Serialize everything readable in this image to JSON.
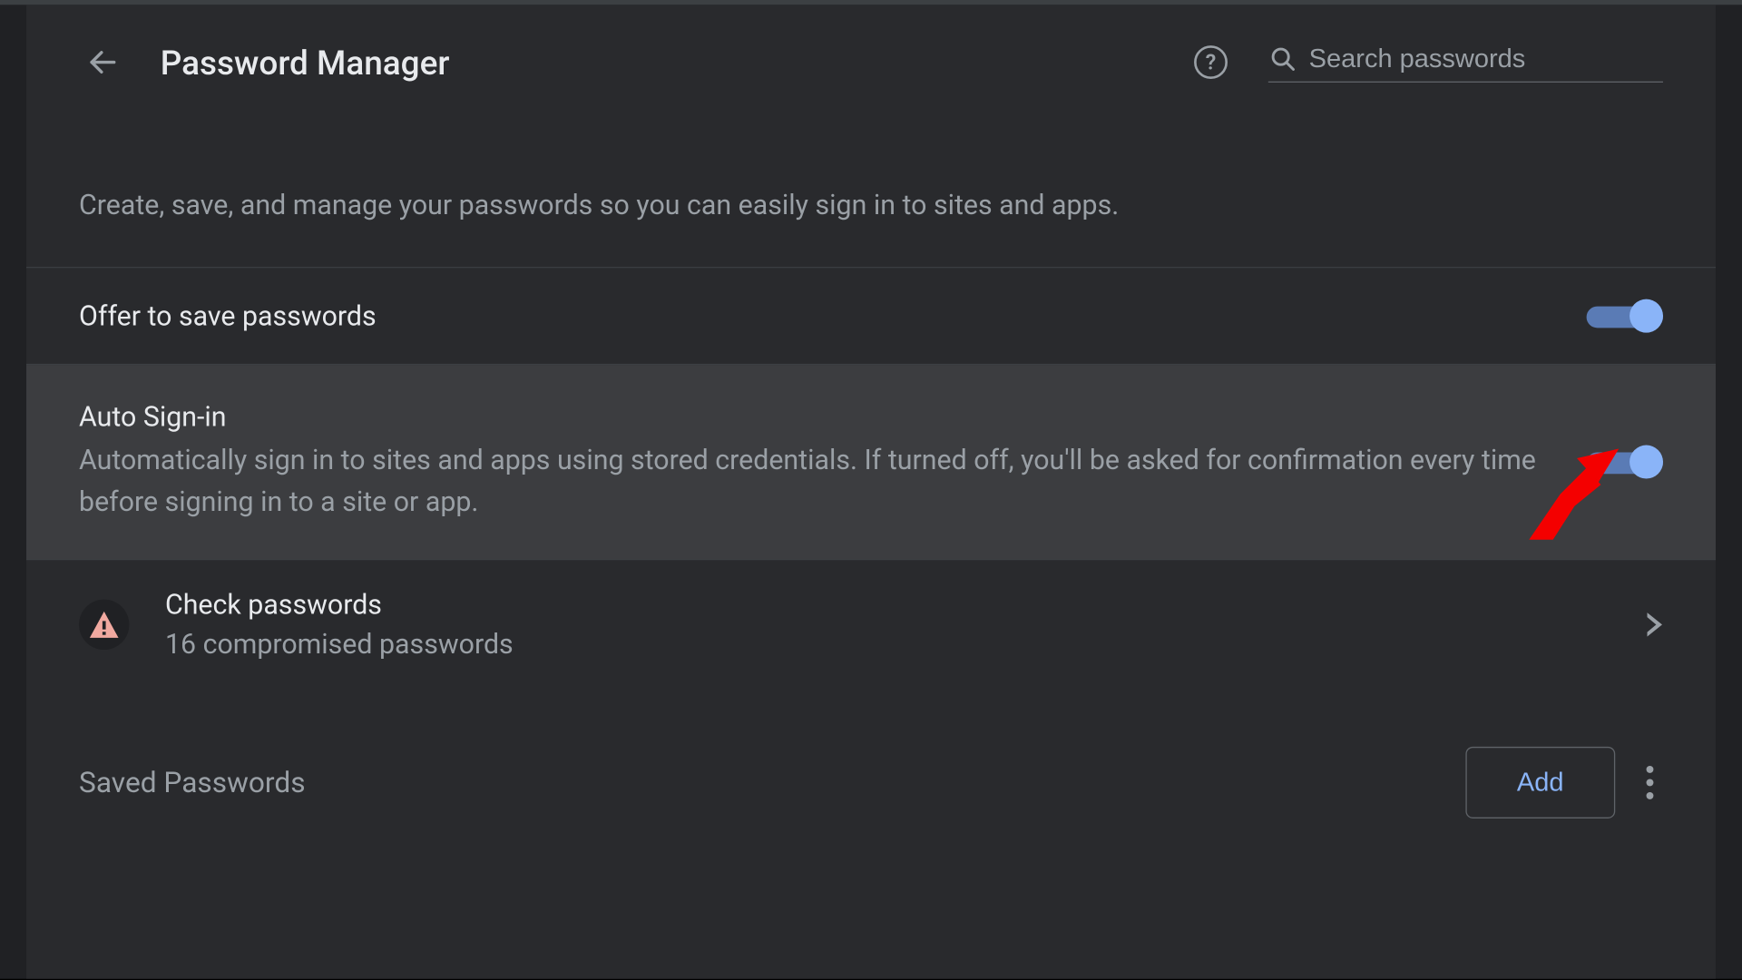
{
  "header": {
    "title": "Password Manager",
    "search_placeholder": "Search passwords"
  },
  "intro": "Create, save, and manage your passwords so you can easily sign in to sites and apps.",
  "settings": {
    "offer_save": {
      "title": "Offer to save passwords"
    },
    "auto_signin": {
      "title": "Auto Sign-in",
      "desc": "Automatically sign in to sites and apps using stored credentials. If turned off, you'll be asked for confirmation every time before signing in to a site or app."
    }
  },
  "check": {
    "title": "Check passwords",
    "subtitle": "16 compromised passwords"
  },
  "saved": {
    "heading": "Saved Passwords",
    "add_label": "Add"
  }
}
